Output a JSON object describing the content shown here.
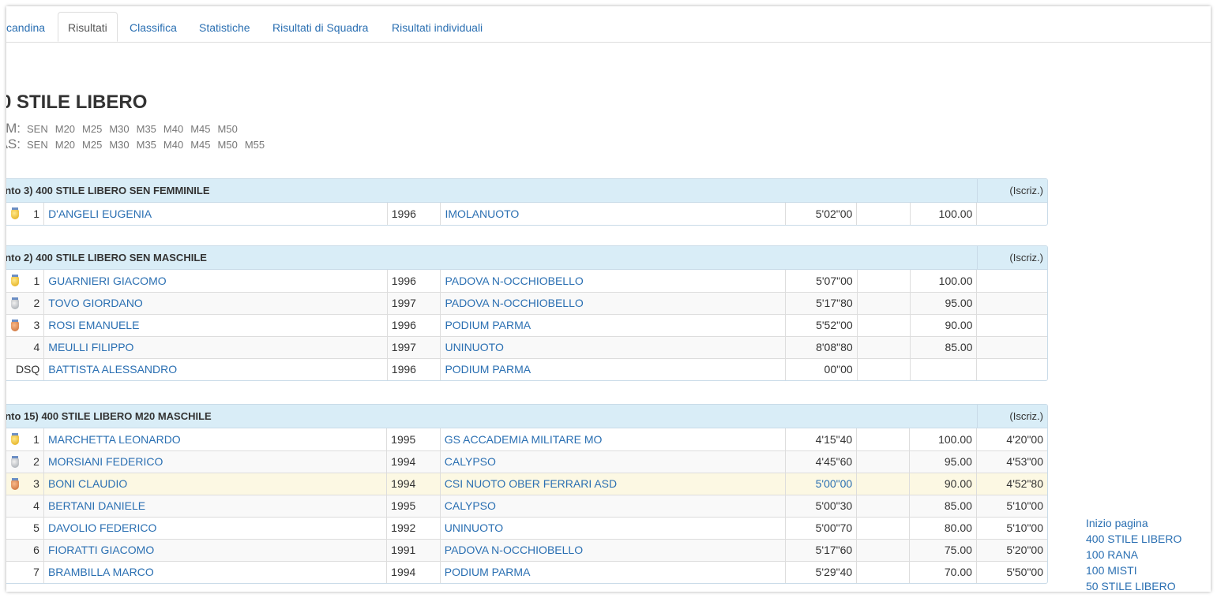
{
  "tabs": [
    "candina",
    "Risultati",
    "Classifica",
    "Statistiche",
    "Risultati di Squadra",
    "Risultati individuali"
  ],
  "event_title": "0 STILE LIBERO",
  "categories": [
    {
      "label": "M:",
      "items": [
        "SEN",
        "M20",
        "M25",
        "M30",
        "M35",
        "M40",
        "M45",
        "M50"
      ]
    },
    {
      "label": "AS:",
      "items": [
        "SEN",
        "M20",
        "M25",
        "M30",
        "M35",
        "M40",
        "M45",
        "M50",
        "M55"
      ]
    }
  ],
  "iscriz_label": "(Iscriz.)",
  "blocks": [
    {
      "title": "ento 3) 400 STILE LIBERO SEN FEMMINILE",
      "rows": [
        {
          "medal": "gold",
          "pos": "1",
          "name": "D'ANGELI EUGENIA",
          "year": "1996",
          "team": "IMOLANUOTO",
          "time": "5'02\"00",
          "points": "100.00",
          "entry": ""
        }
      ]
    },
    {
      "title": "ento 2) 400 STILE LIBERO SEN MASCHILE",
      "rows": [
        {
          "medal": "gold",
          "pos": "1",
          "name": "GUARNIERI GIACOMO",
          "year": "1996",
          "team": "PADOVA N-OCCHIOBELLO",
          "time": "5'07\"00",
          "points": "100.00",
          "entry": ""
        },
        {
          "medal": "silver",
          "pos": "2",
          "name": "TOVO GIORDANO",
          "year": "1997",
          "team": "PADOVA N-OCCHIOBELLO",
          "time": "5'17\"80",
          "points": "95.00",
          "entry": ""
        },
        {
          "medal": "bronze",
          "pos": "3",
          "name": "ROSI EMANUELE",
          "year": "1996",
          "team": "PODIUM PARMA",
          "time": "5'52\"00",
          "points": "90.00",
          "entry": ""
        },
        {
          "medal": "",
          "pos": "4",
          "name": "MEULLI FILIPPO",
          "year": "1997",
          "team": "UNINUOTO",
          "time": "8'08\"80",
          "points": "85.00",
          "entry": ""
        },
        {
          "medal": "",
          "pos": "DSQ",
          "name": "BATTISTA ALESSANDRO",
          "year": "1996",
          "team": "PODIUM PARMA",
          "time": "00\"00",
          "points": "",
          "entry": ""
        }
      ]
    },
    {
      "title": "ento 15) 400 STILE LIBERO M20 MASCHILE",
      "rows": [
        {
          "medal": "gold",
          "pos": "1",
          "name": "MARCHETTA LEONARDO",
          "year": "1995",
          "team": "GS ACCADEMIA MILITARE MO",
          "time": "4'15\"40",
          "points": "100.00",
          "entry": "4'20\"00"
        },
        {
          "medal": "silver",
          "pos": "2",
          "name": "MORSIANI FEDERICO",
          "year": "1994",
          "team": "CALYPSO",
          "time": "4'45\"60",
          "points": "95.00",
          "entry": "4'53\"00"
        },
        {
          "medal": "bronze",
          "pos": "3",
          "name": "BONI CLAUDIO",
          "year": "1994",
          "team": "CSI NUOTO OBER FERRARI ASD",
          "time": "5'00\"00",
          "points": "90.00",
          "entry": "4'52\"80",
          "highlight": true
        },
        {
          "medal": "",
          "pos": "4",
          "name": "BERTANI DANIELE",
          "year": "1995",
          "team": "CALYPSO",
          "time": "5'00\"30",
          "points": "85.00",
          "entry": "5'10\"00"
        },
        {
          "medal": "",
          "pos": "5",
          "name": "DAVOLIO FEDERICO",
          "year": "1992",
          "team": "UNINUOTO",
          "time": "5'00\"70",
          "points": "80.00",
          "entry": "5'10\"00"
        },
        {
          "medal": "",
          "pos": "6",
          "name": "FIORATTI GIACOMO",
          "year": "1991",
          "team": "PADOVA N-OCCHIOBELLO",
          "time": "5'17\"60",
          "points": "75.00",
          "entry": "5'20\"00"
        },
        {
          "medal": "",
          "pos": "7",
          "name": "BRAMBILLA MARCO",
          "year": "1994",
          "team": "PODIUM PARMA",
          "time": "5'29\"40",
          "points": "70.00",
          "entry": "5'50\"00"
        }
      ]
    }
  ],
  "side_links": [
    "Inizio pagina",
    "400 STILE LIBERO",
    "100 RANA",
    "100 MISTI",
    "50 STILE LIBERO"
  ]
}
